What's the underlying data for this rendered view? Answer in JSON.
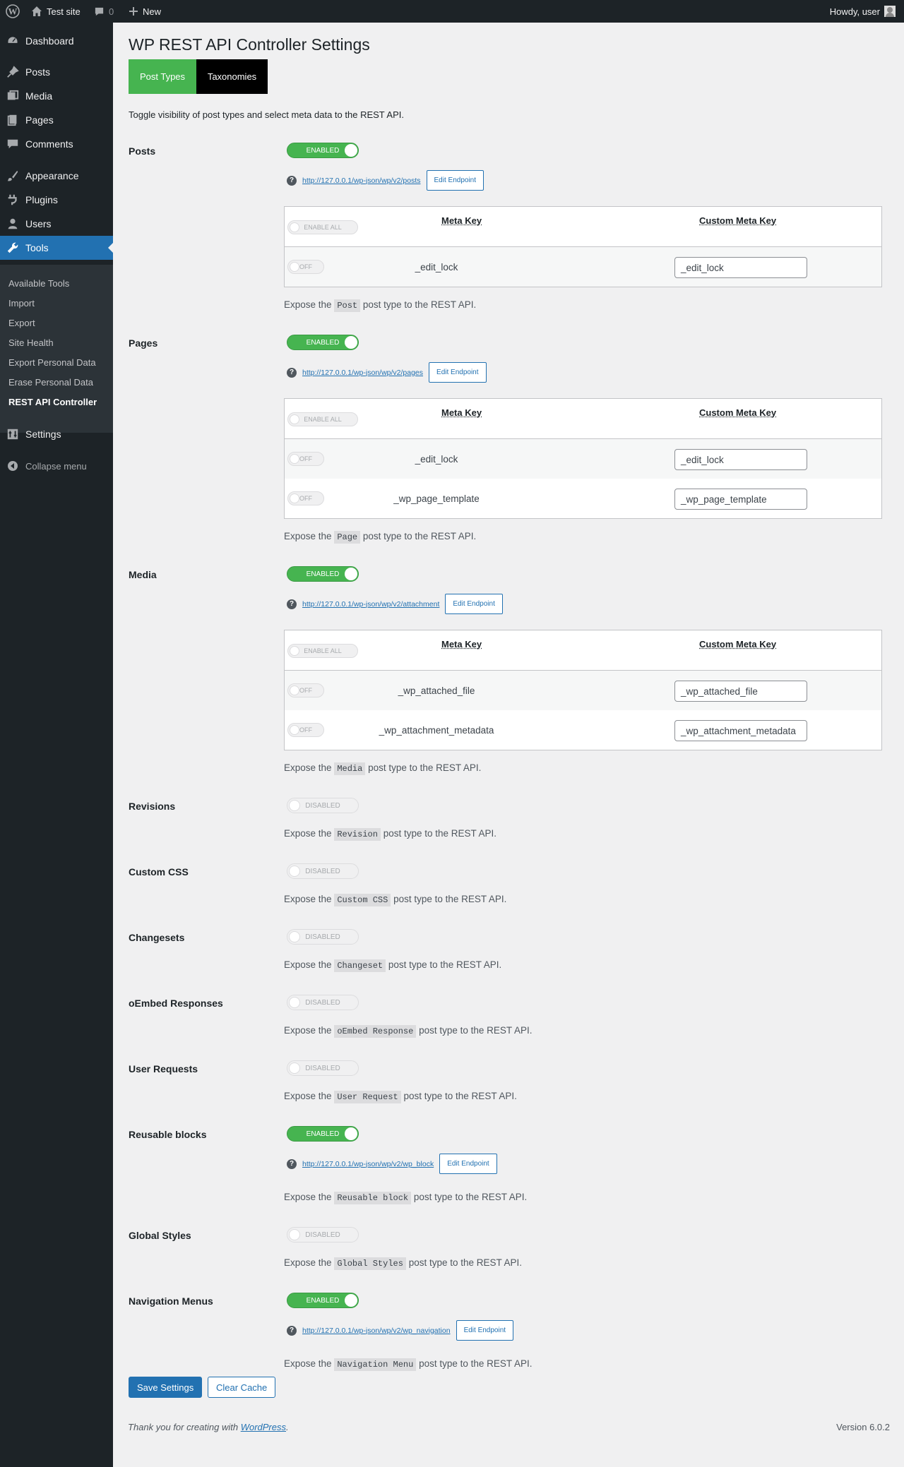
{
  "adminbar": {
    "site_name": "Test site",
    "comments_count": "0",
    "new_label": "New",
    "howdy": "Howdy, user"
  },
  "sidebar": {
    "items": [
      {
        "label": "Dashboard",
        "icon": "dashboard-icon"
      },
      {
        "label": "Posts",
        "icon": "pin-icon"
      },
      {
        "label": "Media",
        "icon": "media-icon"
      },
      {
        "label": "Pages",
        "icon": "pages-icon"
      },
      {
        "label": "Comments",
        "icon": "comment-icon"
      },
      {
        "label": "Appearance",
        "icon": "brush-icon"
      },
      {
        "label": "Plugins",
        "icon": "plugin-icon"
      },
      {
        "label": "Users",
        "icon": "users-icon"
      },
      {
        "label": "Tools",
        "icon": "wrench-icon"
      },
      {
        "label": "Settings",
        "icon": "settings-icon"
      }
    ],
    "submenu": [
      "Available Tools",
      "Import",
      "Export",
      "Site Health",
      "Export Personal Data",
      "Erase Personal Data",
      "REST API Controller"
    ],
    "collapse_label": "Collapse menu"
  },
  "page": {
    "title": "WP REST API Controller Settings",
    "tabs": [
      "Post Types",
      "Taxonomies"
    ],
    "intro": "Toggle visibility of post types and select meta data to the REST API.",
    "desc_prefix": "Expose the",
    "desc_suffix": "post type to the REST API.",
    "edit_endpoint": "Edit Endpoint",
    "enabled": "ENABLED",
    "disabled": "DISABLED",
    "enable_all": "ENABLE ALL",
    "off": "OFF",
    "meta_key_header": "Meta Key",
    "custom_meta_key_header": "Custom Meta Key",
    "help_glyph": "?"
  },
  "sections": {
    "posts": {
      "label": "Posts",
      "url": "http://127.0.0.1/wp-json/wp/v2/posts",
      "type_name": "Post",
      "meta": [
        {
          "key": "_edit_lock",
          "custom": "_edit_lock"
        }
      ]
    },
    "pages": {
      "label": "Pages",
      "url": "http://127.0.0.1/wp-json/wp/v2/pages",
      "type_name": "Page",
      "meta": [
        {
          "key": "_edit_lock",
          "custom": "_edit_lock"
        },
        {
          "key": "_wp_page_template",
          "custom": "_wp_page_template"
        }
      ]
    },
    "media": {
      "label": "Media",
      "url": "http://127.0.0.1/wp-json/wp/v2/attachment",
      "type_name": "Media",
      "meta": [
        {
          "key": "_wp_attached_file",
          "custom": "_wp_attached_file"
        },
        {
          "key": "_wp_attachment_metadata",
          "custom": "_wp_attachment_metadata"
        }
      ]
    },
    "revisions": {
      "label": "Revisions",
      "type_name": "Revision"
    },
    "custom_css": {
      "label": "Custom CSS",
      "type_name": "Custom CSS"
    },
    "changesets": {
      "label": "Changesets",
      "type_name": "Changeset"
    },
    "oembed": {
      "label": "oEmbed Responses",
      "type_name": "oEmbed Response"
    },
    "user_requests": {
      "label": "User Requests",
      "type_name": "User Request"
    },
    "reusable": {
      "label": "Reusable blocks",
      "url": "http://127.0.0.1/wp-json/wp/v2/wp_block",
      "type_name": "Reusable block"
    },
    "global_styles": {
      "label": "Global Styles",
      "type_name": "Global Styles"
    },
    "nav_menus": {
      "label": "Navigation Menus",
      "url": "http://127.0.0.1/wp-json/wp/v2/wp_navigation",
      "type_name": "Navigation Menu"
    }
  },
  "buttons": {
    "save": "Save Settings",
    "clear_cache": "Clear Cache"
  },
  "footer": {
    "thanks_prefix": "Thank you for creating with",
    "wordpress_link": "WordPress",
    "thanks_suffix": ".",
    "version": "Version 6.0.2"
  },
  "colors": {
    "accent": "#2271b1",
    "enabled_green": "#46b450",
    "sidebar_bg": "#1d2327"
  }
}
